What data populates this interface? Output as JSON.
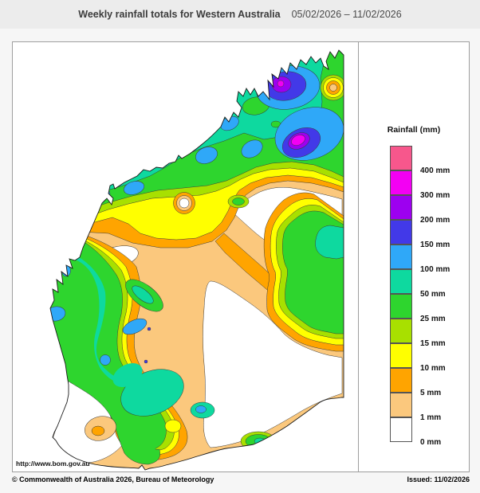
{
  "header": {
    "title": "Weekly rainfall totals for Western Australia",
    "date_range": "05/02/2026 – 11/02/2026"
  },
  "map": {
    "region": "Western Australia",
    "url_label": "http://www.bom.gov.au"
  },
  "legend": {
    "title": "Rainfall (mm)",
    "entries": [
      {
        "label": "400 mm",
        "color_key": "pink"
      },
      {
        "label": "300 mm",
        "color_key": "magenta"
      },
      {
        "label": "200 mm",
        "color_key": "purple"
      },
      {
        "label": "150 mm",
        "color_key": "violet"
      },
      {
        "label": "100 mm",
        "color_key": "lightblue"
      },
      {
        "label": "50 mm",
        "color_key": "teal"
      },
      {
        "label": "25 mm",
        "color_key": "green"
      },
      {
        "label": "15 mm",
        "color_key": "yellowgreen"
      },
      {
        "label": "10 mm",
        "color_key": "yellow"
      },
      {
        "label": "5 mm",
        "color_key": "orange"
      },
      {
        "label": "1 mm",
        "color_key": "tan"
      },
      {
        "label": "0 mm",
        "color_key": "white"
      }
    ]
  },
  "palette": {
    "pink": "#F7578C",
    "magenta": "#F300F3",
    "purple": "#9D00F0",
    "violet": "#4239E8",
    "lightblue": "#2FA8F8",
    "teal": "#0ED99F",
    "green": "#2ED52E",
    "yellowgreen": "#A8E000",
    "yellow": "#FFFF00",
    "orange": "#FFA400",
    "tan": "#FBC87D",
    "white": "#FFFFFF"
  },
  "footer": {
    "copyright": "© Commonwealth of Australia 2026, Bureau of Meteorology",
    "issued": "Issued: 11/02/2026"
  }
}
